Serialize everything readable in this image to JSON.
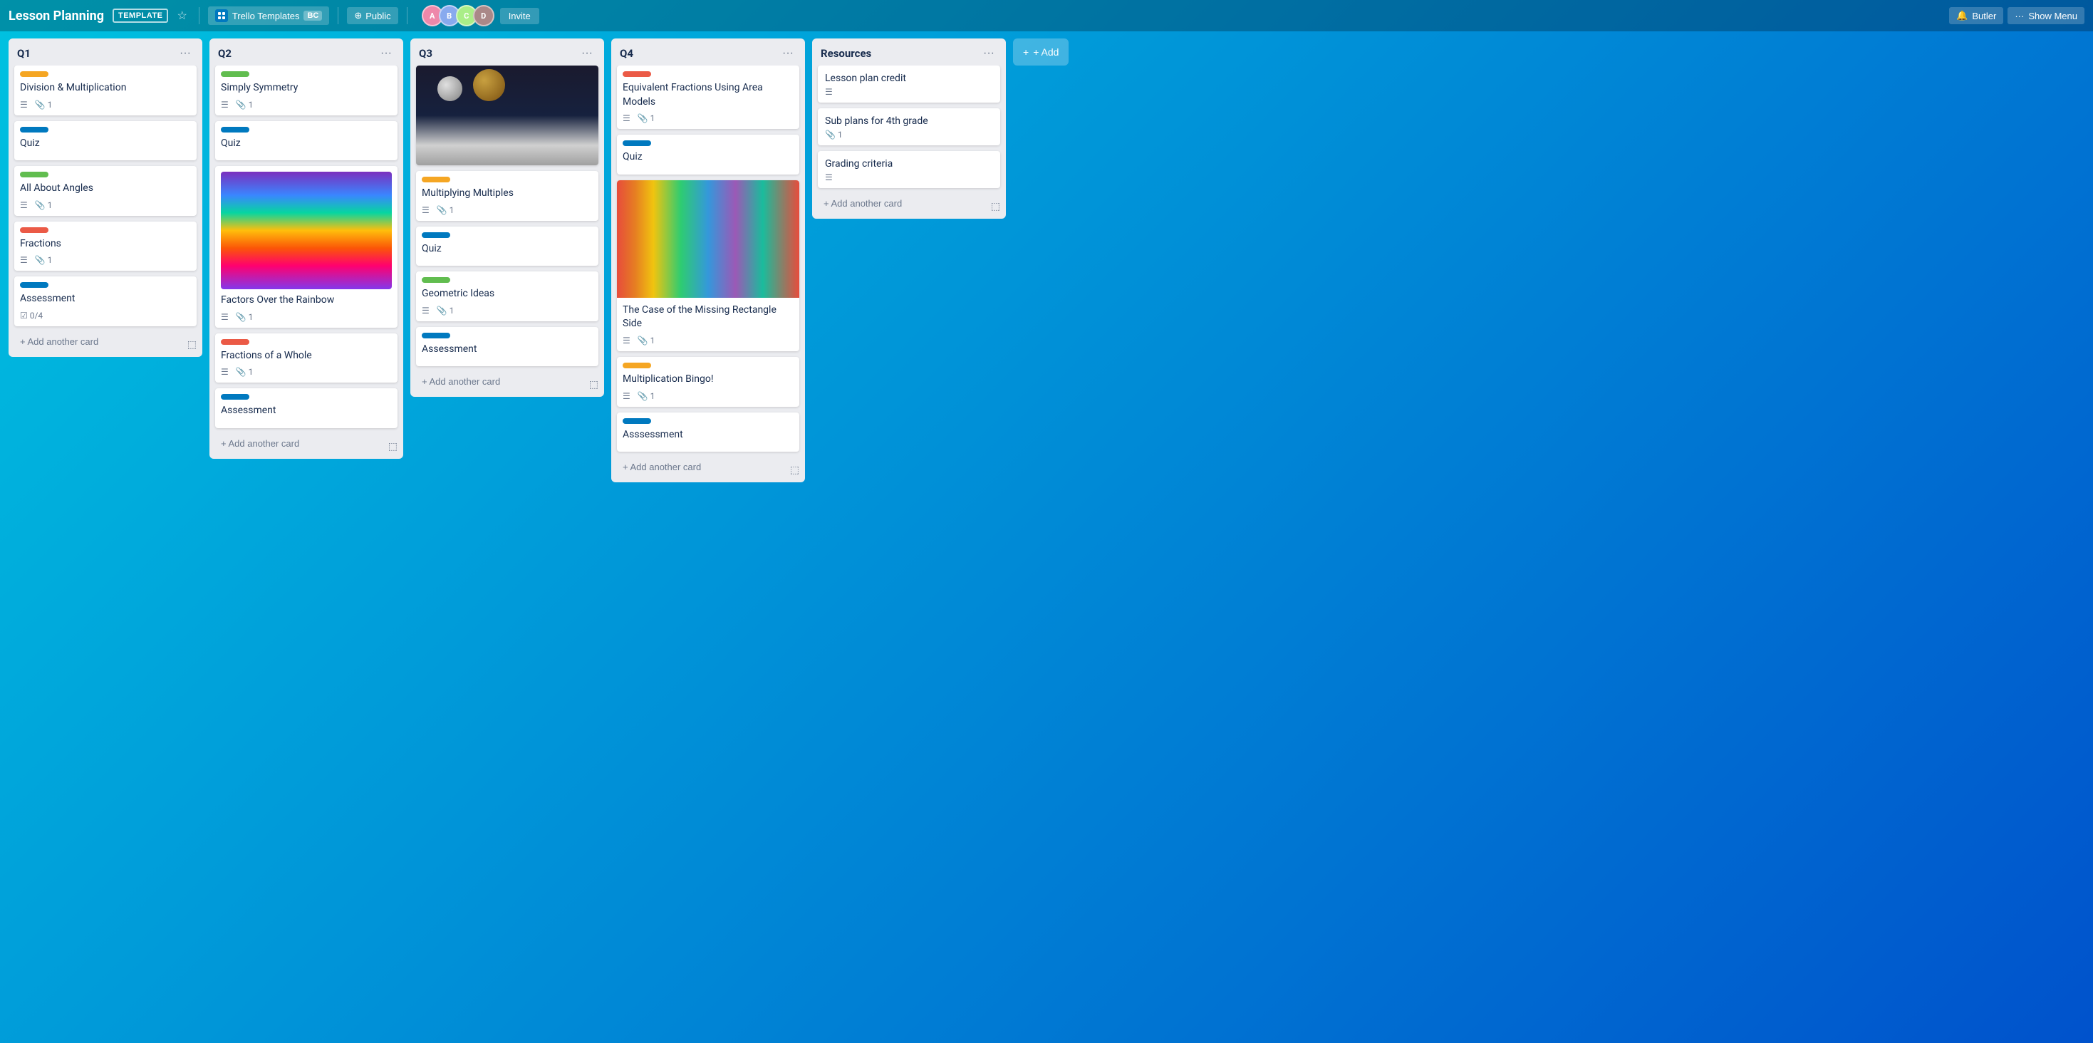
{
  "header": {
    "title": "Lesson Planning",
    "template_badge": "TEMPLATE",
    "workspace_name": "Trello Templates",
    "workspace_badge": "BC",
    "visibility": "Public",
    "invite_label": "Invite",
    "butler_label": "Butler",
    "show_menu_label": "Show Menu",
    "add_label": "+ Add"
  },
  "lists": [
    {
      "id": "q1",
      "title": "Q1",
      "cards": [
        {
          "id": "c1",
          "label_color": "yellow",
          "title": "Division & Multiplication",
          "has_description": true,
          "attachment_count": "1"
        },
        {
          "id": "c2",
          "label_color": "blue",
          "title": "Quiz",
          "has_description": true,
          "attachment_count": null
        },
        {
          "id": "c3",
          "label_color": "green",
          "title": "All About Angles",
          "has_description": true,
          "attachment_count": "1"
        },
        {
          "id": "c4",
          "label_color": "red",
          "title": "Fractions",
          "has_description": true,
          "attachment_count": "1"
        },
        {
          "id": "c5",
          "label_color": "blue",
          "title": "Assessment",
          "has_description": false,
          "checklist": "0/4"
        }
      ],
      "add_card_label": "+ Add another card"
    },
    {
      "id": "q2",
      "title": "Q2",
      "cards": [
        {
          "id": "c6",
          "label_color": "green",
          "title": "Simply Symmetry",
          "has_description": true,
          "attachment_count": "1",
          "image_type": null
        },
        {
          "id": "c7",
          "label_color": "blue",
          "title": "Quiz",
          "has_description": true,
          "attachment_count": null,
          "image_type": null
        },
        {
          "id": "c8",
          "label_color": null,
          "title": "Factors Over the Rainbow",
          "has_description": true,
          "attachment_count": "1",
          "image_type": "rainbow"
        },
        {
          "id": "c9",
          "label_color": "red",
          "title": "Fractions of a Whole",
          "has_description": true,
          "attachment_count": "1",
          "image_type": null
        },
        {
          "id": "c10",
          "label_color": "blue",
          "title": "Assessment",
          "has_description": false,
          "attachment_count": null,
          "image_type": null
        }
      ],
      "add_card_label": "+ Add another card"
    },
    {
      "id": "q3",
      "title": "Q3",
      "cards": [
        {
          "id": "c11",
          "label_color": null,
          "title": null,
          "image_type": "spheres",
          "title_after_image": null
        },
        {
          "id": "c11b",
          "label_color": "yellow",
          "title": "Multiplying Multiples",
          "has_description": true,
          "attachment_count": "1",
          "image_type": null
        },
        {
          "id": "c12",
          "label_color": "blue",
          "title": "Quiz",
          "has_description": false,
          "attachment_count": null,
          "image_type": null
        },
        {
          "id": "c13",
          "label_color": "green",
          "title": "Geometric Ideas",
          "has_description": true,
          "attachment_count": "1",
          "image_type": null
        },
        {
          "id": "c14",
          "label_color": "blue",
          "title": "Assessment",
          "has_description": false,
          "attachment_count": null,
          "image_type": null
        }
      ],
      "add_card_label": "+ Add another card"
    },
    {
      "id": "q4",
      "title": "Q4",
      "cards": [
        {
          "id": "c15",
          "label_color": "red",
          "title": "Equivalent Fractions Using Area Models",
          "has_description": true,
          "attachment_count": "1",
          "image_type": null
        },
        {
          "id": "c16",
          "label_color": "blue",
          "title": "Quiz",
          "has_description": false,
          "attachment_count": null,
          "image_type": null
        },
        {
          "id": "c17",
          "label_color": null,
          "title": "The Case of the Missing Rectangle Side",
          "has_description": false,
          "attachment_count": null,
          "image_type": "tunnel"
        },
        {
          "id": "c18",
          "label_color": "green",
          "title": null,
          "has_description": true,
          "attachment_count": "1",
          "image_type": null,
          "title_label": "The Case of the Missing Rectangle Side"
        },
        {
          "id": "c19",
          "label_color": "yellow",
          "title": "Multiplication Bingo!",
          "has_description": true,
          "attachment_count": "1",
          "image_type": null
        },
        {
          "id": "c20",
          "label_color": "blue",
          "title": "Asssessment",
          "has_description": false,
          "attachment_count": null,
          "image_type": null
        }
      ],
      "add_card_label": "+ Add another card"
    },
    {
      "id": "resources",
      "title": "Resources",
      "cards": [
        {
          "id": "r1",
          "title": "Lesson plan credit",
          "has_description": true,
          "attachment_count": null
        },
        {
          "id": "r2",
          "title": "Sub plans for 4th grade",
          "has_description": false,
          "attachment_count": "1"
        },
        {
          "id": "r3",
          "title": "Grading criteria",
          "has_description": true,
          "attachment_count": null
        }
      ],
      "add_card_label": "+ Add another card"
    }
  ],
  "icons": {
    "description": "☰",
    "attachment": "📎",
    "checklist": "☑",
    "menu": "···",
    "plus": "+",
    "star": "☆",
    "globe": "⊕",
    "card_template": "⬚",
    "lock": "🔒",
    "butler": "🔔"
  }
}
